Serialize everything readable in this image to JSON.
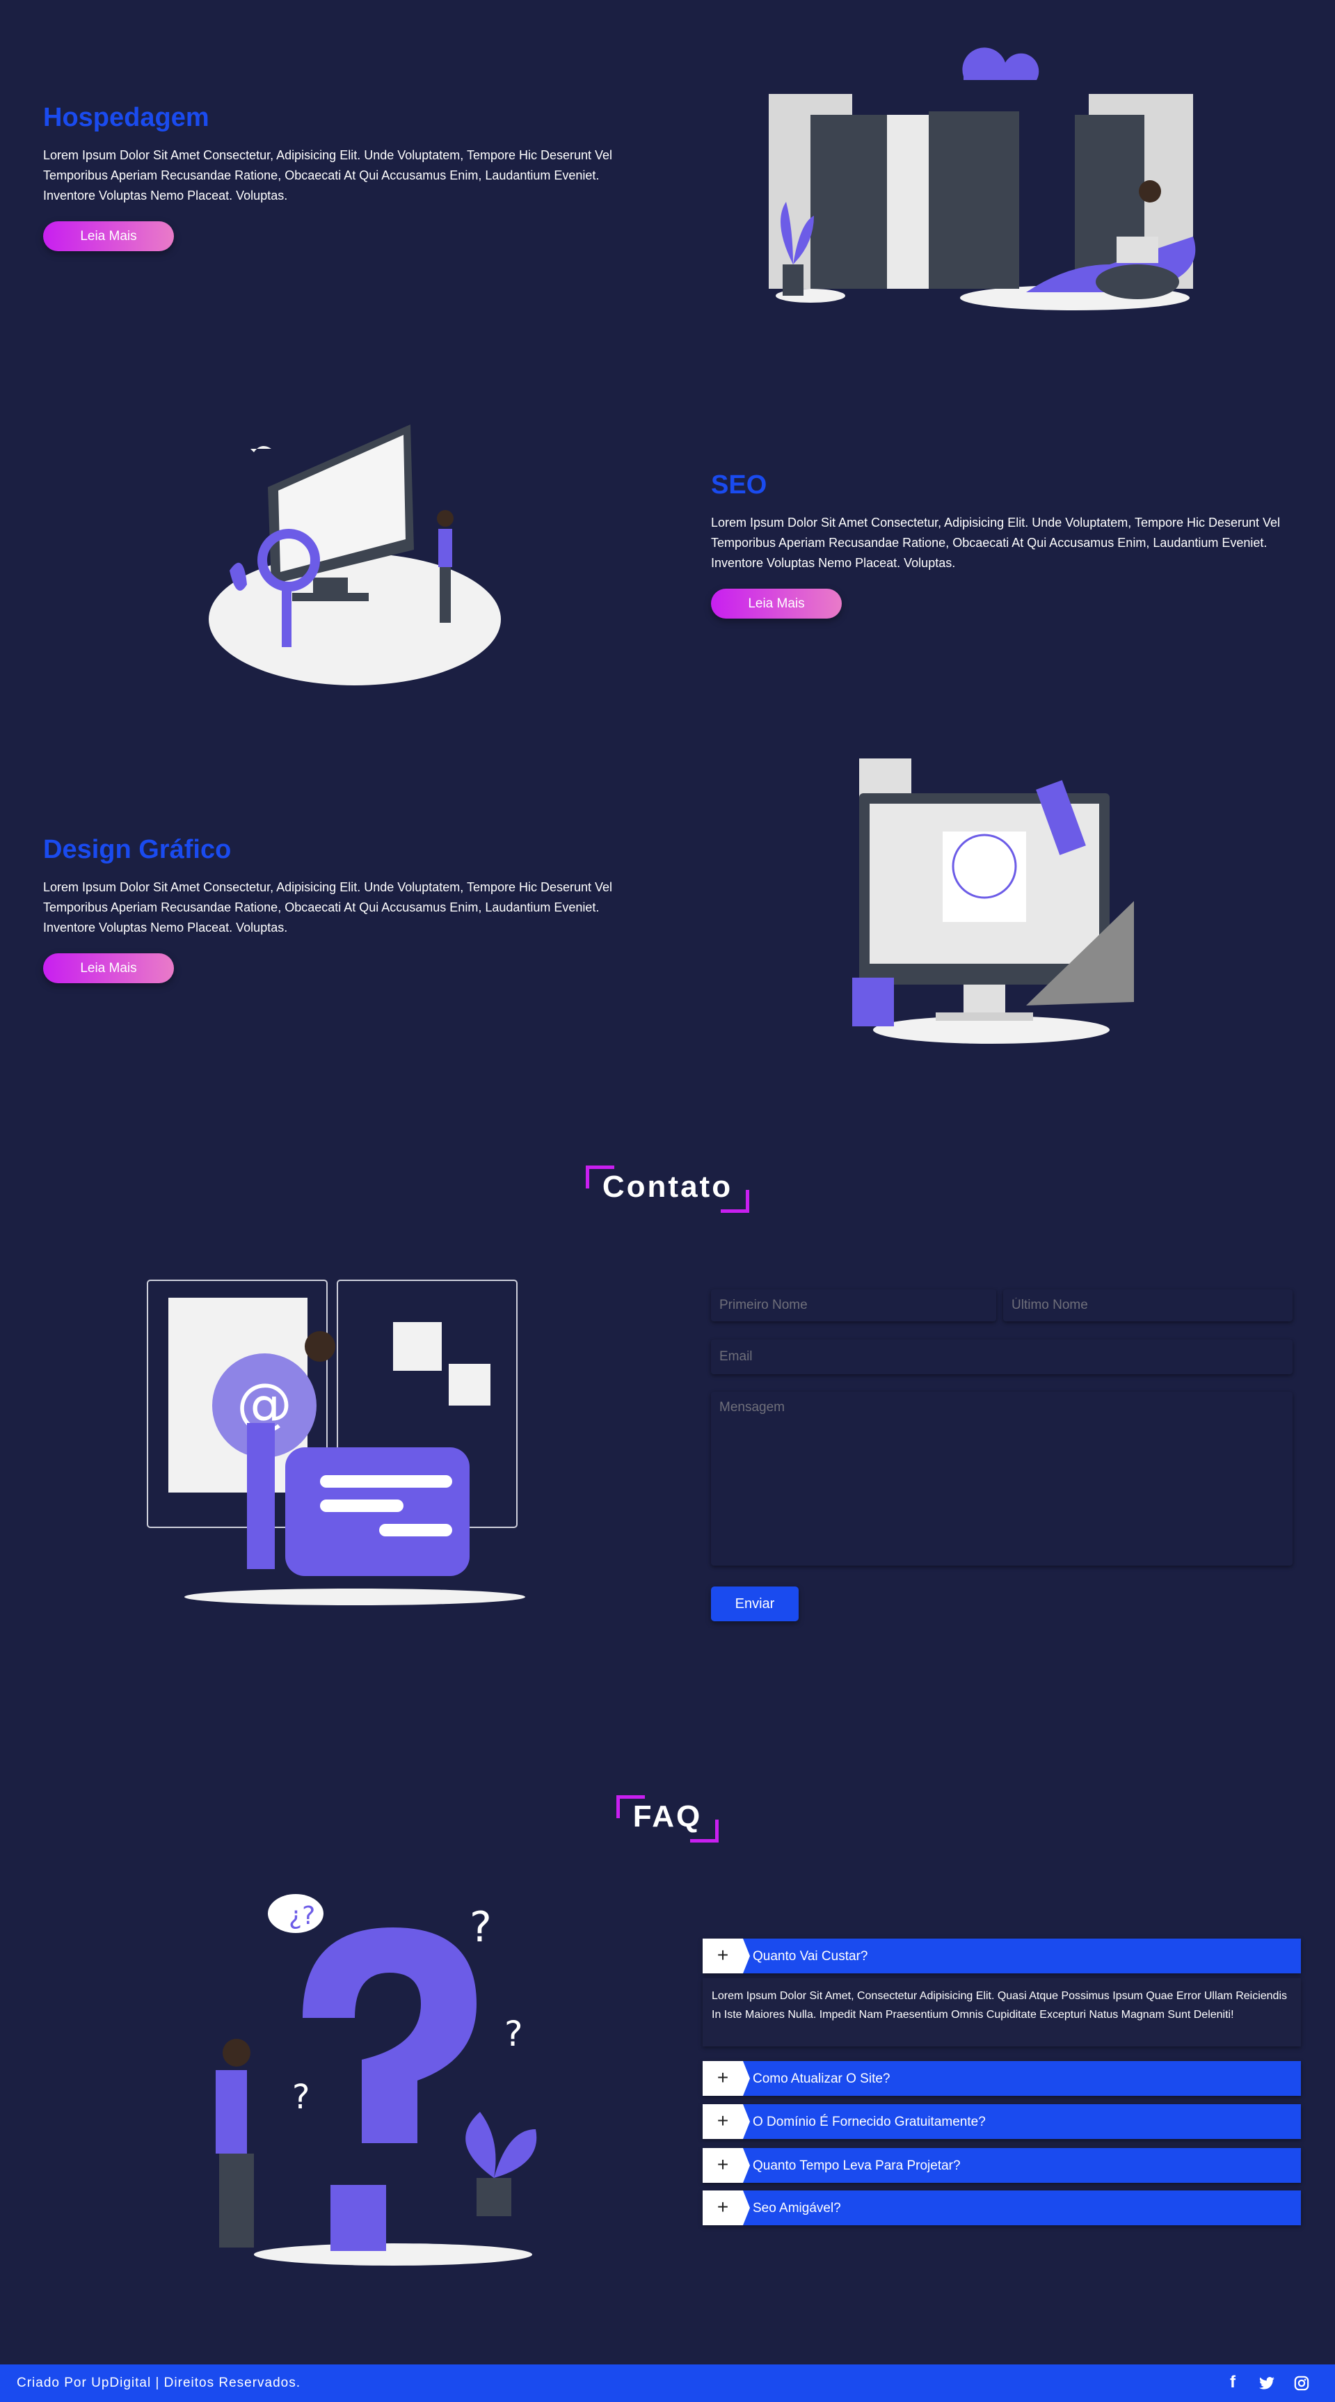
{
  "colors": {
    "background": "#1b1f42",
    "accent": "#1a4bef",
    "highlight": "#c81ff0",
    "illustration": "#6c5ce7"
  },
  "services": [
    {
      "title": "Hospedagem",
      "text": "Lorem Ipsum Dolor Sit Amet Consectetur, Adipisicing Elit. Unde Voluptatem, Tempore Hic Deserunt Vel Temporibus Aperiam Recusandae Ratione, Obcaecati At Qui Accusamus Enim, Laudantium Eveniet. Inventore Voluptas Nemo Placeat. Voluptas.",
      "button": "Leia Mais"
    },
    {
      "title": "SEO",
      "text": "Lorem Ipsum Dolor Sit Amet Consectetur, Adipisicing Elit. Unde Voluptatem, Tempore Hic Deserunt Vel Temporibus Aperiam Recusandae Ratione, Obcaecati At Qui Accusamus Enim, Laudantium Eveniet. Inventore Voluptas Nemo Placeat. Voluptas.",
      "button": "Leia Mais"
    },
    {
      "title": "Design Gráfico",
      "text": "Lorem Ipsum Dolor Sit Amet Consectetur, Adipisicing Elit. Unde Voluptatem, Tempore Hic Deserunt Vel Temporibus Aperiam Recusandae Ratione, Obcaecati At Qui Accusamus Enim, Laudantium Eveniet. Inventore Voluptas Nemo Placeat. Voluptas.",
      "button": "Leia Mais"
    }
  ],
  "contact": {
    "title": "Contato",
    "first_name_placeholder": "Primeiro Nome",
    "last_name_placeholder": "Último Nome",
    "email_placeholder": "Email",
    "message_placeholder": "Mensagem",
    "submit": "Enviar"
  },
  "faq": {
    "title": "FAQ",
    "items": [
      {
        "q": "Quanto Vai Custar?",
        "expanded": true,
        "a": "Lorem Ipsum Dolor Sit Amet, Consectetur Adipisicing Elit. Quasi Atque Possimus Ipsum Quae Error Ullam Reiciendis In Iste Maiores Nulla. Impedit Nam Praesentium Omnis Cupiditate Excepturi Natus Magnam Sunt Deleniti!"
      },
      {
        "q": "Como Atualizar O Site?"
      },
      {
        "q": "O Domínio É Fornecido Gratuitamente?"
      },
      {
        "q": "Quanto Tempo Leva Para Projetar?"
      },
      {
        "q": "Seo Amigável?"
      }
    ],
    "toggle_icon": "+"
  },
  "footer": {
    "text": "Criado Por UpDigital | Direitos Reservados.",
    "social": [
      "facebook-icon",
      "twitter-icon",
      "instagram-icon"
    ]
  }
}
